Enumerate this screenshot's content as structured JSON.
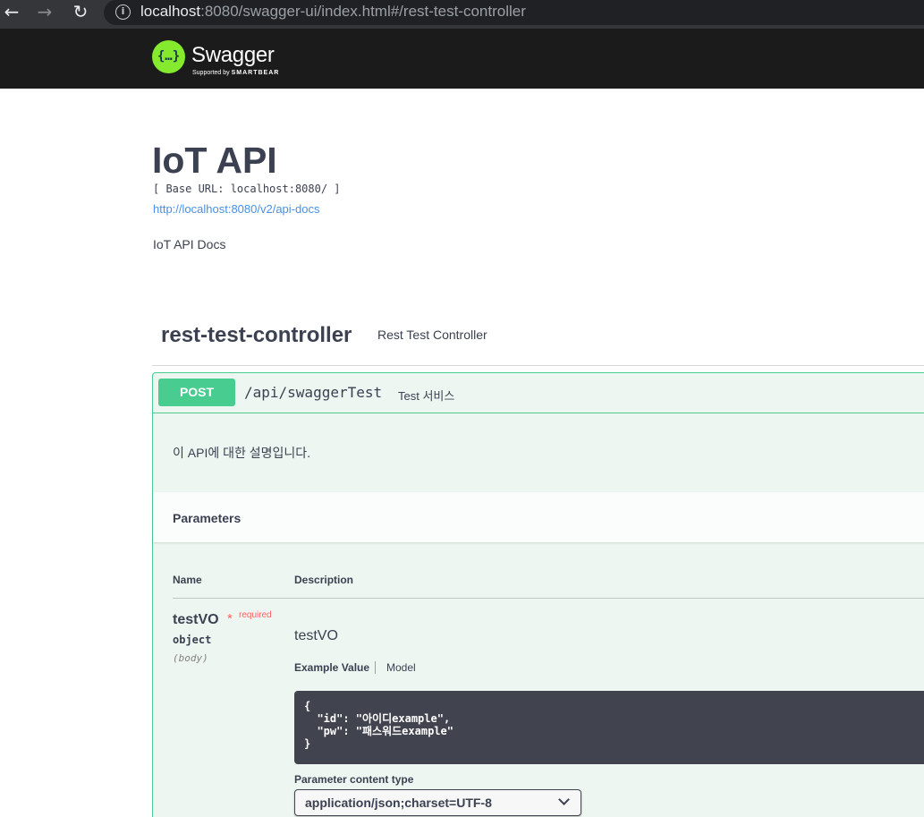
{
  "browser": {
    "back_icon": "←",
    "forward_icon": "→",
    "reload_icon": "↻",
    "info_icon": "i",
    "url_host": "localhost",
    "url_rest": ":8080/swagger-ui/index.html#/rest-test-controller"
  },
  "topbar": {
    "logo_glyph": "{…}",
    "logo_text": "Swagger",
    "logo_sub_prefix": "Supported by ",
    "logo_sub_brand": "SMARTBEAR"
  },
  "info": {
    "title": "IoT API",
    "base_url": "[ Base URL: localhost:8080/ ]",
    "docs_link": "http://localhost:8080/v2/api-docs",
    "description": "IoT API Docs"
  },
  "tag": {
    "name": "rest-test-controller",
    "description": "Rest Test Controller"
  },
  "operation": {
    "method": "POST",
    "path": "/api/swaggerTest",
    "summary": "Test 서비스",
    "description": "이 API에 대한 설명입니다.",
    "parameters_title": "Parameters",
    "columns": {
      "name": "Name",
      "description": "Description"
    },
    "param": {
      "name": "testVO",
      "required_star": "*",
      "required_label": "required",
      "type": "object",
      "in": "(body)",
      "description": "testVO",
      "tab_example": "Example Value",
      "tab_model": "Model",
      "example_json": "{\n  \"id\": \"아이디example\",\n  \"pw\": \"패스워드example\"\n}"
    },
    "content_type_label": "Parameter content type",
    "content_type_value": "application/json;charset=UTF-8"
  },
  "colors": {
    "post": "#49cc90",
    "topbar": "#1b1b1b",
    "logo_green": "#85ea2d",
    "link": "#4990e2",
    "required": "#ff6060"
  }
}
